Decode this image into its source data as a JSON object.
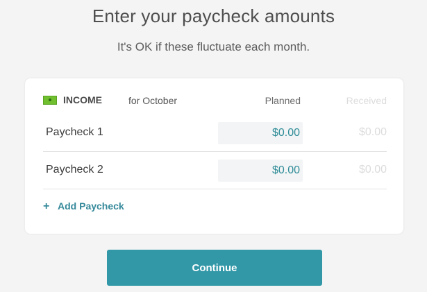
{
  "header": {
    "title": "Enter your paycheck amounts",
    "subtitle": "It's OK if these fluctuate each month."
  },
  "card": {
    "icon": "money-icon",
    "section_label": "INCOME",
    "month_label": "for October",
    "columns": {
      "planned": "Planned",
      "received": "Received"
    },
    "rows": [
      {
        "label": "Paycheck 1",
        "planned": "$0.00",
        "received": "$0.00"
      },
      {
        "label": "Paycheck 2",
        "planned": "$0.00",
        "received": "$0.00"
      }
    ],
    "add_label": "Add Paycheck",
    "add_icon": "+"
  },
  "actions": {
    "continue_label": "Continue"
  },
  "colors": {
    "accent": "#3298a8",
    "link": "#35899a",
    "planned_text": "#2f8c98",
    "money_icon": "#6fbf2f"
  }
}
